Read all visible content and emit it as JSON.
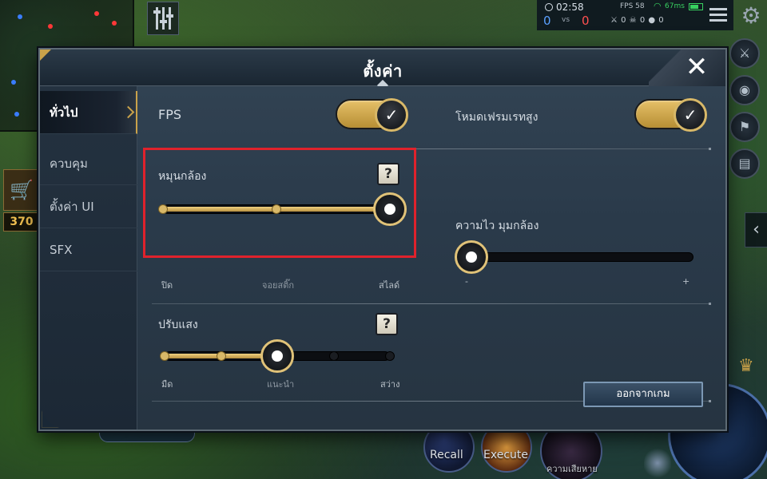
{
  "hud": {
    "time": "02:58",
    "kills_team": "0",
    "vs": "vs",
    "kills_enemy": "0",
    "fps": "FPS 58",
    "ping": "67ms",
    "stats": "⚔ 0 ☠ 0 ● 0",
    "gold": "370",
    "skills": [
      "Recall",
      "Execute"
    ],
    "damage_label": "ความเสียหาย"
  },
  "dialog": {
    "title": "ตั้งค่า",
    "close_symbol": "✕"
  },
  "sidebar": {
    "items": [
      {
        "label": "ทั่วไป",
        "active": true
      },
      {
        "label": "ควบคุม",
        "active": false
      },
      {
        "label": "ตั้งค่า UI",
        "active": false
      },
      {
        "label": "SFX",
        "active": false
      }
    ]
  },
  "settings": {
    "fps": {
      "label": "FPS",
      "on": true,
      "check": "✓"
    },
    "high_frame_mode": {
      "label": "โหมดเฟรมเรทสูง",
      "on": true,
      "check": "✓"
    },
    "camera_rotate": {
      "label": "หมุนกล้อง",
      "help": "?",
      "options": [
        "ปิด",
        "จอยสติ๊ก",
        "สไลด์"
      ],
      "selected_index": 2
    },
    "camera_speed": {
      "label": "ความไว มุมกล้อง",
      "min_label": "-",
      "max_label": "+",
      "value_fraction": 0.04
    },
    "brightness": {
      "label": "ปรับแสง",
      "help": "?",
      "options": [
        "มืด",
        "แนะนำ",
        "สว่าง"
      ],
      "selected_index": 2,
      "stops": 5
    }
  },
  "footer": {
    "exit_label": "ออกจากเกม"
  },
  "colors": {
    "accent_gold": "#c9a24a",
    "highlight_red": "#e0222c",
    "panel": "#2a3a4a"
  },
  "icons": [
    "close-icon",
    "check-icon",
    "help-icon",
    "gear-icon",
    "menu-icon",
    "cart-icon",
    "chevron-right-icon",
    "chevron-left-icon"
  ]
}
